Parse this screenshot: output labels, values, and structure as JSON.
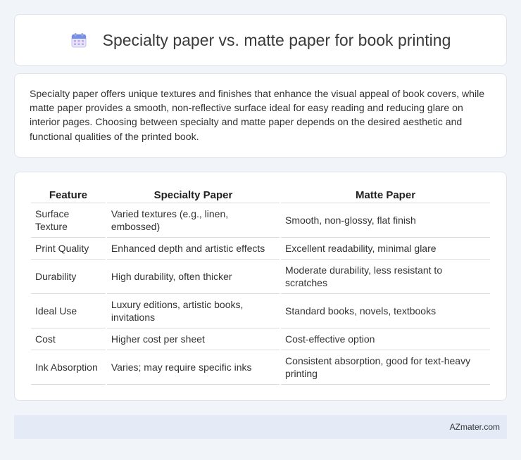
{
  "header": {
    "icon": "calendar-icon",
    "title": "Specialty paper vs. matte paper for book printing"
  },
  "intro": {
    "text": "Specialty paper offers unique textures and finishes that enhance the visual appeal of book covers, while matte paper provides a smooth, non-reflective surface ideal for easy reading and reducing glare on interior pages. Choosing between specialty and matte paper depends on the desired aesthetic and functional qualities of the printed book."
  },
  "table": {
    "headers": [
      "Feature",
      "Specialty Paper",
      "Matte Paper"
    ],
    "rows": [
      [
        "Surface Texture",
        "Varied textures (e.g., linen, embossed)",
        "Smooth, non-glossy, flat finish"
      ],
      [
        "Print Quality",
        "Enhanced depth and artistic effects",
        "Excellent readability, minimal glare"
      ],
      [
        "Durability",
        "High durability, often thicker",
        "Moderate durability, less resistant to scratches"
      ],
      [
        "Ideal Use",
        "Luxury editions, artistic books, invitations",
        "Standard books, novels, textbooks"
      ],
      [
        "Cost",
        "Higher cost per sheet",
        "Cost-effective option"
      ],
      [
        "Ink Absorption",
        "Varies; may require specific inks",
        "Consistent absorption, good for text-heavy printing"
      ]
    ]
  },
  "footer": {
    "source": "AZmater.com"
  }
}
